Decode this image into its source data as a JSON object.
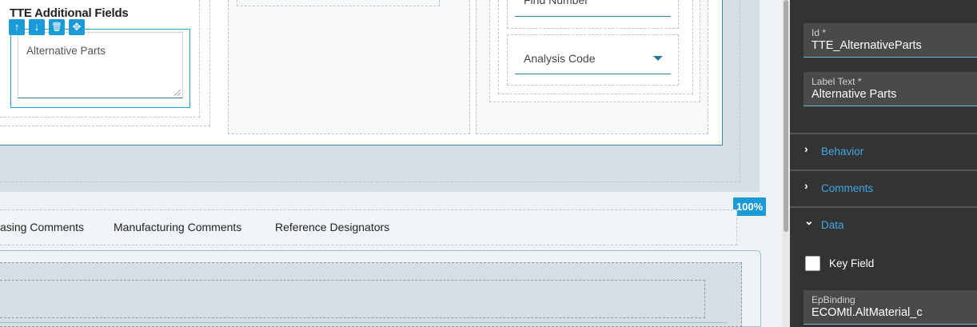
{
  "designer": {
    "section_title": "TTE Additional Fields",
    "controls": {
      "move_up": "↑",
      "move_down": "↓",
      "delete": "🗑",
      "drag": "✥"
    },
    "textarea_value": "Alternative Parts",
    "find_number_label": "Find Number",
    "analysis_code_label": "Analysis Code",
    "zoom_badge": "100%",
    "tabs": [
      "asing Comments",
      "Manufacturing Comments",
      "Reference Designators"
    ]
  },
  "properties": {
    "id_label": "Id *",
    "id_value": "TTE_AlternativeParts",
    "label_text_label": "Label Text *",
    "label_text_value": "Alternative Parts",
    "sections": {
      "behavior": "Behavior",
      "comments": "Comments",
      "data": "Data"
    },
    "chevron_right": "›",
    "chevron_down": "⌄",
    "key_field_label": "Key Field",
    "key_field_checked": false,
    "epbinding_label": "EpBinding",
    "epbinding_value": "ECOMtl.AltMaterial_c"
  },
  "colors": {
    "accent": "#1a9ad6",
    "section_link": "#3fa9e6",
    "side_panel_bg": "#333333"
  }
}
